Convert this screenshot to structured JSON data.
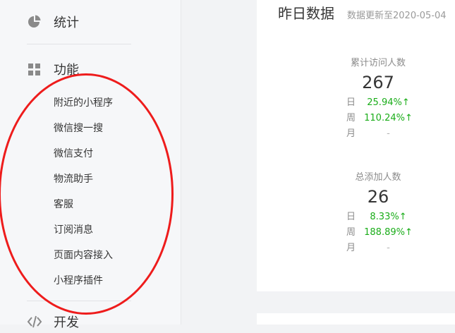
{
  "sidebar": {
    "stats_label": "统计",
    "function_label": "功能",
    "dev_label": "开发",
    "items": [
      {
        "label": "附近的小程序"
      },
      {
        "label": "微信搜一搜"
      },
      {
        "label": "微信支付"
      },
      {
        "label": "物流助手"
      },
      {
        "label": "客服"
      },
      {
        "label": "订阅消息"
      },
      {
        "label": "页面内容接入"
      },
      {
        "label": "小程序插件"
      }
    ]
  },
  "card": {
    "title": "昨日数据",
    "updated": "数据更新至2020-05-04",
    "metrics": [
      {
        "label": "累计访问人数",
        "value": "267",
        "rows": [
          {
            "key": "日",
            "value": "25.94%↑"
          },
          {
            "key": "周",
            "value": "110.24%↑"
          },
          {
            "key": "月",
            "value": "-"
          }
        ]
      },
      {
        "label": "总添加人数",
        "value": "26",
        "rows": [
          {
            "key": "日",
            "value": "8.33%↑"
          },
          {
            "key": "周",
            "value": "188.89%↑"
          },
          {
            "key": "月",
            "value": "-"
          }
        ]
      }
    ]
  },
  "colors": {
    "up": "#1aad19",
    "annotation": "#ee1c1c",
    "sidebar_bg": "#f6f7f9"
  }
}
